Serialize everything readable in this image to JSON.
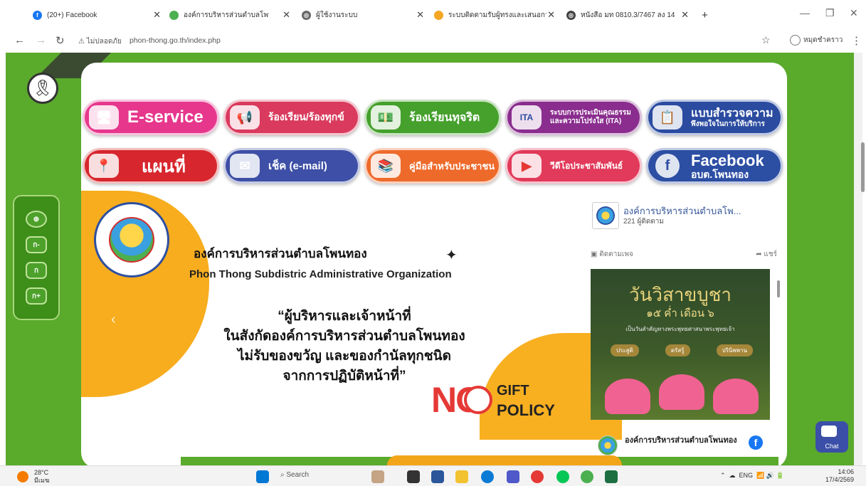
{
  "browser": {
    "tabs": [
      {
        "title": "(20+) Facebook",
        "color": "#1877f2"
      },
      {
        "title": "องค์การบริหารส่วนตำบลโพนทอง",
        "color": "#4caf50"
      },
      {
        "title": "ผู้ใช้งานระบบ",
        "color": "#555555"
      },
      {
        "title": "ระบบติดตามรับผู้ทรงและเสนอการประเ",
        "color": "#f5a623"
      },
      {
        "title": "หนังสือ มท 0810.3/7467 ลง 14",
        "color": "#444444"
      }
    ],
    "new_tab": "+",
    "url_warning": "ไม่ปลอดภัย",
    "url": "phon-thong.go.th/index.php",
    "profile": "หมุดชำคราว"
  },
  "services": {
    "row1": [
      {
        "label": "E-service",
        "color": "#e6378d",
        "icon": "monitor-icon"
      },
      {
        "label": "ร้องเรียน/ร้องทุกข์",
        "color": "#d93a5d",
        "icon": "megaphone-icon"
      },
      {
        "label": "ร้องเรียนทุจริต",
        "color": "#45a02c",
        "icon": "money-icon"
      },
      {
        "label": "ระบบการประเมินคุณธรรม",
        "label2": "และความโปร่งใส (ITA)",
        "color": "#8a2d8e",
        "icon": "ita-icon"
      },
      {
        "label": "แบบสำรวจความ",
        "label2": "พึงพอใจในการให้บริการ",
        "color": "#2a4ba0",
        "icon": "clipboard-icon"
      }
    ],
    "row2": [
      {
        "label": "แผนที่",
        "color": "#d7262d",
        "icon": "map-pin-icon"
      },
      {
        "label": "เช็ค (e-mail)",
        "color": "#3d4fa6",
        "icon": "email-icon"
      },
      {
        "label": "คู่มือสำหรับประชาชน",
        "color": "#ee6a2b",
        "icon": "book-icon"
      },
      {
        "label": "วีดีโอประชาสัมพันธ์",
        "color": "#e23a5a",
        "icon": "youtube-icon"
      },
      {
        "label": "Facebook",
        "label2": "อบต.โพนทอง",
        "color": "#2c4ea3",
        "icon": "facebook-icon"
      }
    ]
  },
  "side_widget": {
    "items": [
      "ก-",
      "ก",
      "ก+"
    ]
  },
  "org": {
    "name_th": "องค์การบริหารส่วนตำบลโพนทอง",
    "name_en": "Phon Thong Subdistric Administrative Organization"
  },
  "slogan": {
    "line1": "“ผู้บริหารและเจ้าหน้าที่",
    "line2": "ในสังกัดองค์การบริหารส่วนตำบลโพนทอง",
    "line3": "ไม่รับของขวัญ  และของกำนัลทุกชนิด",
    "line4": "จากการปฏิบัติหน้าที่”"
  },
  "no_gift": {
    "no": "NO",
    "gift": "GIFT",
    "policy": "POLICY"
  },
  "facebook_widget": {
    "page_name": "องค์การบริหารส่วนตำบลโพ...",
    "followers": "221 ผู้ติดตาม",
    "follow_label": "ติดตามเพจ",
    "share_label": "แชร์",
    "post_title": "วันวิสาขบูชา",
    "post_subtitle": "๑๕ ค่ำ เดือน ๖",
    "post_small": "เป็นวันสำคัญทางพระพุทธศาสนาพระพุทธเจ้า",
    "post_buttons": [
      "ประสูติ",
      "ตรัสรู้",
      "ปรินิพพาน"
    ],
    "footer_name": "องค์การบริหารส่วนตำบลโพนทอง"
  },
  "chat": {
    "label": "Chat"
  },
  "taskbar": {
    "temp": "28°C",
    "weather": "มีเมฆ",
    "search": "Search",
    "lang": "ENG",
    "time": "14:06",
    "date": "17/4/2569"
  }
}
